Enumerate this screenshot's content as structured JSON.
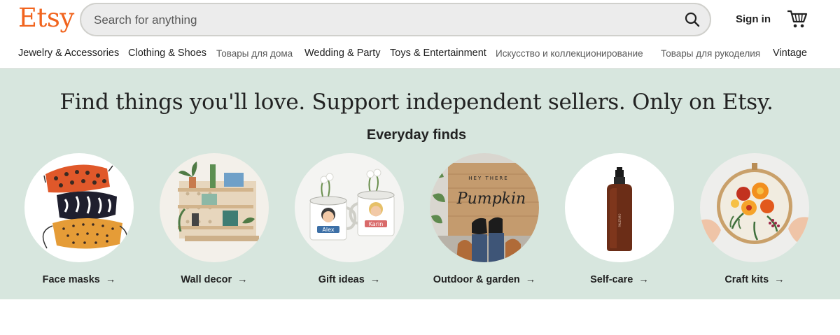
{
  "header": {
    "logo": "Etsy",
    "search_placeholder": "Search for anything",
    "sign_in": "Sign in"
  },
  "nav": [
    {
      "label": "Jewelry & Accessories"
    },
    {
      "label": "Clothing & Shoes"
    },
    {
      "label": "Товары для дома"
    },
    {
      "label": "Wedding & Party"
    },
    {
      "label": "Toys & Entertainment"
    },
    {
      "label": "Искусство и коллекционирование"
    },
    {
      "label": "Товары для рукоделия"
    },
    {
      "label": "Vintage"
    }
  ],
  "hero": {
    "title": "Find things you'll love. Support independent sellers. Only on Etsy.",
    "section_title": "Everyday finds"
  },
  "categories": [
    {
      "label": "Face masks",
      "arrow": "→"
    },
    {
      "label": "Wall decor",
      "arrow": "→"
    },
    {
      "label": "Gift ideas",
      "arrow": "→"
    },
    {
      "label": "Outdoor & garden",
      "arrow": "→"
    },
    {
      "label": "Self-care",
      "arrow": "→"
    },
    {
      "label": "Craft kits",
      "arrow": "→"
    }
  ],
  "images": {
    "mug_names": [
      "Alex",
      "Karin"
    ],
    "doormat_top": "HEY THERE",
    "doormat_main": "Pumpkin",
    "bottle_label": "PALERMO"
  },
  "colors": {
    "brand": "#f1641e",
    "hero_bg": "#d7e6de",
    "search_bg": "#ececec"
  },
  "icons": {
    "search": "search-icon",
    "cart": "shopping-cart-icon",
    "arrow": "arrow-right-icon"
  }
}
